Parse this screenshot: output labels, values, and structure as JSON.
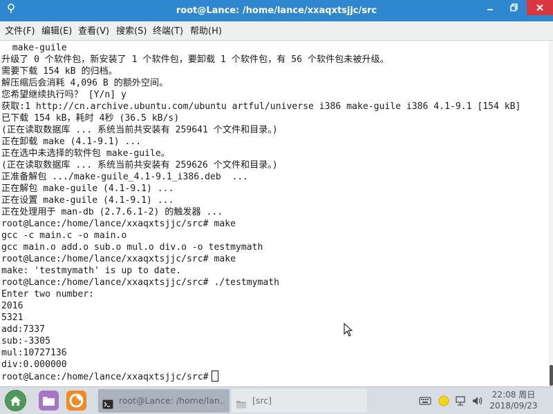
{
  "window": {
    "title": "root@Lance: /home/lance/xxaqxtsjjc/src"
  },
  "menu": [
    {
      "label": "文件(F)"
    },
    {
      "label": "编辑(E)"
    },
    {
      "label": "查看(V)"
    },
    {
      "label": "搜索(S)"
    },
    {
      "label": "终端(T)"
    },
    {
      "label": "帮助(H)"
    }
  ],
  "terminal": {
    "lines": [
      "  make-guile",
      "升级了 0 个软件包，新安装了 1 个软件包，要卸载 1 个软件包，有 56 个软件包未被升级。",
      "需要下载 154 kB 的归档。",
      "解压缩后会消耗 4,096 B 的额外空间。",
      "您希望继续执行吗？ [Y/n] y",
      "获取:1 http://cn.archive.ubuntu.com/ubuntu artful/universe i386 make-guile i386 4.1-9.1 [154 kB]",
      "已下载 154 kB，耗时 4秒 (36.5 kB/s)",
      "(正在读取数据库 ... 系统当前共安装有 259641 个文件和目录。)",
      "正在卸载 make (4.1-9.1) ...",
      "正在选中未选择的软件包 make-guile。",
      "(正在读取数据库 ... 系统当前共安装有 259626 个文件和目录。)",
      "正准备解包 .../make-guile_4.1-9.1_i386.deb  ...",
      "正在解包 make-guile (4.1-9.1) ...",
      "正在设置 make-guile (4.1-9.1) ...",
      "正在处理用于 man-db (2.7.6.1-2) 的触发器 ...",
      "root@Lance:/home/lance/xxaqxtsjjc/src# make",
      "gcc -c main.c -o main.o",
      "gcc main.o add.o sub.o mul.o div.o -o testmymath",
      "root@Lance:/home/lance/xxaqxtsjjc/src# make",
      "make: 'testmymath' is up to date.",
      "root@Lance:/home/lance/xxaqxtsjjc/src# ./testmymath",
      "Enter two number:",
      "2016",
      "5321",
      "add:7337",
      "sub:-3305",
      "mul:10727136",
      "div:0.000000"
    ],
    "prompt": "root@Lance:/home/lance/xxaqxtsjjc/src#"
  },
  "taskbar": {
    "launchers": [
      {
        "icon": "home-icon"
      },
      {
        "icon": "file-manager-icon"
      },
      {
        "icon": "firefox-icon"
      }
    ],
    "tasks": [
      {
        "label": "root@Lance: /home/lan…",
        "icon": "terminal-icon",
        "active": true
      },
      {
        "label": "[src]",
        "icon": "folder-icon",
        "active": false
      }
    ],
    "clock": {
      "time": "22:08 周日",
      "date": "2018/09/23"
    }
  },
  "colors": {
    "titlebar": "#2f88cf",
    "close_button": "#d9363e",
    "menubar": "#eeefef",
    "terminal_bg": "#ffffff",
    "taskbar": "#d8dde3"
  }
}
